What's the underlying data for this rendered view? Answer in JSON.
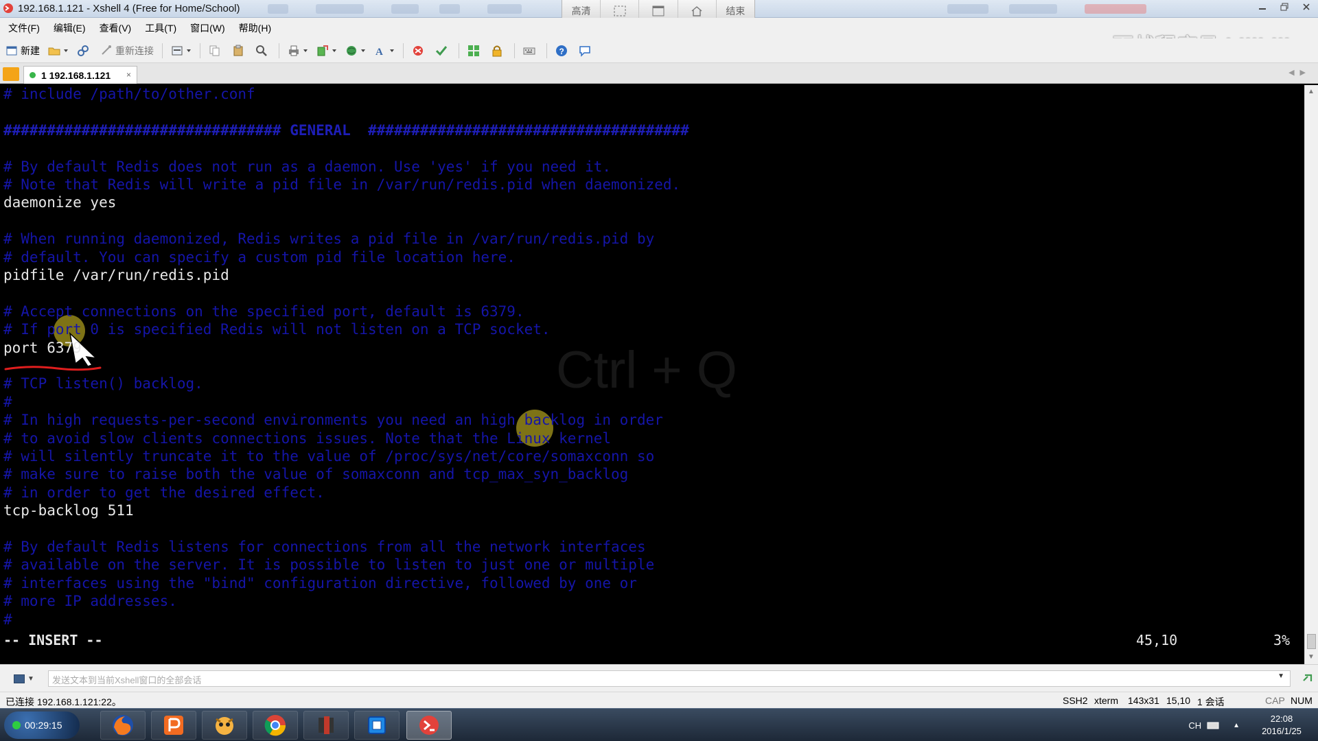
{
  "window": {
    "title": "192.168.1.121 - Xshell 4 (Free for Home/School)"
  },
  "recorder": {
    "buttons": [
      "高清",
      "",
      "",
      "",
      "结束"
    ]
  },
  "menu": {
    "items": [
      "文件(F)",
      "编辑(E)",
      "查看(V)",
      "工具(T)",
      "窗口(W)",
      "帮助(H)"
    ]
  },
  "watermark": "百战程序员 bilibili",
  "toolbar": {
    "new_label": "新建",
    "reconnect_label": "重新连接"
  },
  "tab": {
    "label": "1 192.168.1.121",
    "close": "×"
  },
  "terminal": {
    "lines": [
      {
        "text": "# include /path/to/other.conf",
        "kind": "comment"
      },
      {
        "text": "",
        "kind": "blank"
      },
      {
        "text": "################################ GENERAL  #####################################",
        "kind": "hash"
      },
      {
        "text": "",
        "kind": "blank"
      },
      {
        "text": "# By default Redis does not run as a daemon. Use 'yes' if you need it.",
        "kind": "comment"
      },
      {
        "text": "# Note that Redis will write a pid file in /var/run/redis.pid when daemonized.",
        "kind": "comment"
      },
      {
        "text": "daemonize yes",
        "kind": "setting"
      },
      {
        "text": "",
        "kind": "blank"
      },
      {
        "text": "# When running daemonized, Redis writes a pid file in /var/run/redis.pid by",
        "kind": "comment"
      },
      {
        "text": "# default. You can specify a custom pid file location here.",
        "kind": "comment"
      },
      {
        "text": "pidfile /var/run/redis.pid",
        "kind": "setting"
      },
      {
        "text": "",
        "kind": "blank"
      },
      {
        "text": "# Accept connections on the specified port, default is 6379.",
        "kind": "comment"
      },
      {
        "text": "# If port 0 is specified Redis will not listen on a TCP socket.",
        "kind": "comment"
      },
      {
        "text": "port 6379",
        "kind": "setting"
      },
      {
        "text": "",
        "kind": "blank"
      },
      {
        "text": "# TCP listen() backlog.",
        "kind": "comment"
      },
      {
        "text": "#",
        "kind": "comment"
      },
      {
        "text": "# In high requests-per-second environments you need an high backlog in order",
        "kind": "comment"
      },
      {
        "text": "# to avoid slow clients connections issues. Note that the Linux kernel",
        "kind": "comment"
      },
      {
        "text": "# will silently truncate it to the value of /proc/sys/net/core/somaxconn so",
        "kind": "comment"
      },
      {
        "text": "# make sure to raise both the value of somaxconn and tcp_max_syn_backlog",
        "kind": "comment"
      },
      {
        "text": "# in order to get the desired effect.",
        "kind": "comment"
      },
      {
        "text": "tcp-backlog 511",
        "kind": "setting"
      },
      {
        "text": "",
        "kind": "blank"
      },
      {
        "text": "# By default Redis listens for connections from all the network interfaces",
        "kind": "comment"
      },
      {
        "text": "# available on the server. It is possible to listen to just one or multiple",
        "kind": "comment"
      },
      {
        "text": "# interfaces using the \"bind\" configuration directive, followed by one or",
        "kind": "comment"
      },
      {
        "text": "# more IP addresses.",
        "kind": "comment"
      },
      {
        "text": "#",
        "kind": "comment"
      }
    ],
    "mode": "-- INSERT --",
    "cursor_pos": "45,10",
    "scroll_pct": "3%",
    "overlay_hotkey": "Ctrl + Q"
  },
  "compose": {
    "placeholder": "发送文本到当前Xshell窗口的全部会话"
  },
  "statusbar": {
    "connection": "已连接 192.168.1.121:22。",
    "protocol": "SSH2",
    "term": "xterm",
    "size": "143x31",
    "cursor": "15,10",
    "sessions": "1 会话",
    "caps": "CAP",
    "num": "NUM"
  },
  "taskbar": {
    "timer": "00:29:15",
    "ime": "CH",
    "time": "22:08",
    "date": "2016/1/25"
  },
  "colors": {
    "comment": "#1515a8",
    "setting": "#e8e8e8",
    "terminal_bg": "#000000"
  }
}
